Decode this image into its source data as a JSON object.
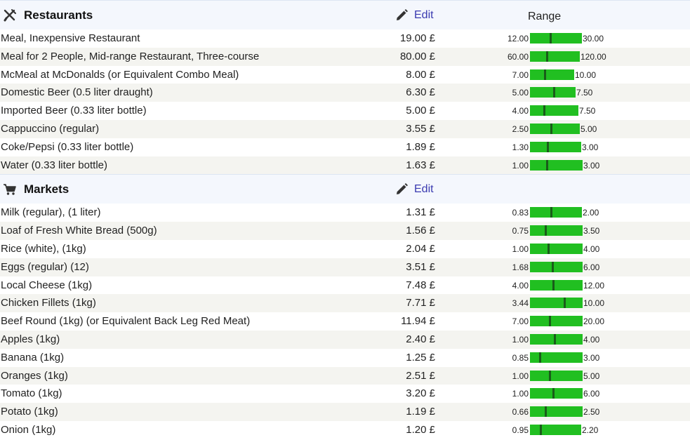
{
  "currency": "£",
  "colors": {
    "bar": "#21bf21",
    "marker": "#1a5c1a",
    "edit_link": "#3a3ab0",
    "header_bg": "#f4f7fd",
    "stripe": "#f4f4f0"
  },
  "sections": [
    {
      "title": "Restaurants",
      "icon": "utensils-icon",
      "edit_label": "Edit",
      "range_header": "Range",
      "items": [
        {
          "name": "Meal, Inexpensive Restaurant",
          "price": "19.00 £",
          "value": 19.0,
          "min": "12.00",
          "max": "30.00",
          "min_v": 12,
          "max_v": 30
        },
        {
          "name": "Meal for 2 People, Mid-range Restaurant, Three-course",
          "price": "80.00 £",
          "value": 80.0,
          "min": "60.00",
          "max": "120.00",
          "min_v": 60,
          "max_v": 120
        },
        {
          "name": "McMeal at McDonalds (or Equivalent Combo Meal)",
          "price": "8.00 £",
          "value": 8.0,
          "min": "7.00",
          "max": "10.00",
          "min_v": 7,
          "max_v": 10
        },
        {
          "name": "Domestic Beer (0.5 liter draught)",
          "price": "6.30 £",
          "value": 6.3,
          "min": "5.00",
          "max": "7.50",
          "min_v": 5,
          "max_v": 7.5
        },
        {
          "name": "Imported Beer (0.33 liter bottle)",
          "price": "5.00 £",
          "value": 5.0,
          "min": "4.00",
          "max": "7.50",
          "min_v": 4,
          "max_v": 7.5
        },
        {
          "name": "Cappuccino (regular)",
          "price": "3.55 £",
          "value": 3.55,
          "min": "2.50",
          "max": "5.00",
          "min_v": 2.5,
          "max_v": 5
        },
        {
          "name": "Coke/Pepsi (0.33 liter bottle)",
          "price": "1.89 £",
          "value": 1.89,
          "min": "1.30",
          "max": "3.00",
          "min_v": 1.3,
          "max_v": 3
        },
        {
          "name": "Water (0.33 liter bottle)",
          "price": "1.63 £",
          "value": 1.63,
          "min": "1.00",
          "max": "3.00",
          "min_v": 1,
          "max_v": 3
        }
      ]
    },
    {
      "title": "Markets",
      "icon": "shopping-cart-icon",
      "edit_label": "Edit",
      "range_header": "",
      "items": [
        {
          "name": "Milk (regular), (1 liter)",
          "price": "1.31 £",
          "value": 1.31,
          "min": "0.83",
          "max": "2.00",
          "min_v": 0.83,
          "max_v": 2
        },
        {
          "name": "Loaf of Fresh White Bread (500g)",
          "price": "1.56 £",
          "value": 1.56,
          "min": "0.75",
          "max": "3.50",
          "min_v": 0.75,
          "max_v": 3.5
        },
        {
          "name": "Rice (white), (1kg)",
          "price": "2.04 £",
          "value": 2.04,
          "min": "1.00",
          "max": "4.00",
          "min_v": 1,
          "max_v": 4
        },
        {
          "name": "Eggs (regular) (12)",
          "price": "3.51 £",
          "value": 3.51,
          "min": "1.68",
          "max": "6.00",
          "min_v": 1.68,
          "max_v": 6
        },
        {
          "name": "Local Cheese (1kg)",
          "price": "7.48 £",
          "value": 7.48,
          "min": "4.00",
          "max": "12.00",
          "min_v": 4,
          "max_v": 12
        },
        {
          "name": "Chicken Fillets (1kg)",
          "price": "7.71 £",
          "value": 7.71,
          "min": "3.44",
          "max": "10.00",
          "min_v": 3.44,
          "max_v": 10
        },
        {
          "name": "Beef Round (1kg) (or Equivalent Back Leg Red Meat)",
          "price": "11.94 £",
          "value": 11.94,
          "min": "7.00",
          "max": "20.00",
          "min_v": 7,
          "max_v": 20
        },
        {
          "name": "Apples (1kg)",
          "price": "2.40 £",
          "value": 2.4,
          "min": "1.00",
          "max": "4.00",
          "min_v": 1,
          "max_v": 4
        },
        {
          "name": "Banana (1kg)",
          "price": "1.25 £",
          "value": 1.25,
          "min": "0.85",
          "max": "3.00",
          "min_v": 0.85,
          "max_v": 3
        },
        {
          "name": "Oranges (1kg)",
          "price": "2.51 £",
          "value": 2.51,
          "min": "1.00",
          "max": "5.00",
          "min_v": 1,
          "max_v": 5
        },
        {
          "name": "Tomato (1kg)",
          "price": "3.20 £",
          "value": 3.2,
          "min": "1.00",
          "max": "6.00",
          "min_v": 1,
          "max_v": 6
        },
        {
          "name": "Potato (1kg)",
          "price": "1.19 £",
          "value": 1.19,
          "min": "0.66",
          "max": "2.50",
          "min_v": 0.66,
          "max_v": 2.5
        },
        {
          "name": "Onion (1kg)",
          "price": "1.20 £",
          "value": 1.2,
          "min": "0.95",
          "max": "2.20",
          "min_v": 0.95,
          "max_v": 2.2
        }
      ]
    }
  ]
}
